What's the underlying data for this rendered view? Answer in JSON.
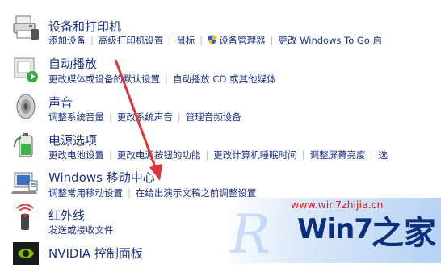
{
  "items": [
    {
      "title": "设备和打印机",
      "icon": "printer-icon",
      "links": [
        "添加设备",
        "高级打印机设置",
        "鼠标",
        "设备管理器",
        "更改 Windows To Go 启"
      ]
    },
    {
      "title": "自动播放",
      "icon": "autoplay-icon",
      "links": [
        "更改媒体或设备的默认设置",
        "自动播放 CD 或其他媒体"
      ]
    },
    {
      "title": "声音",
      "icon": "speaker-icon",
      "links": [
        "调整系统音量",
        "更改系统声音",
        "管理音频设备"
      ]
    },
    {
      "title": "电源选项",
      "icon": "battery-icon",
      "links": [
        "更改电池设置",
        "更改电源按钮的功能",
        "更改计算机睡眠时间",
        "调整屏幕亮度",
        "选"
      ]
    },
    {
      "title": "Windows 移动中心",
      "icon": "mobility-center-icon",
      "links": [
        "调整常用移动设置",
        "在给出演示文稿之前调整设置"
      ]
    },
    {
      "title": "红外线",
      "icon": "infrared-icon",
      "links": [
        "发送或接收文件"
      ]
    },
    {
      "title": "NVIDIA 控制面板",
      "icon": "nvidia-icon",
      "links": []
    }
  ],
  "watermark": {
    "url": "www.win7zhijia.cn",
    "logo": "Win7",
    "suffix": "之家"
  },
  "colors": {
    "link": "#1e3287",
    "separator": "#b9b9b9",
    "arrow": "#e0343a"
  }
}
